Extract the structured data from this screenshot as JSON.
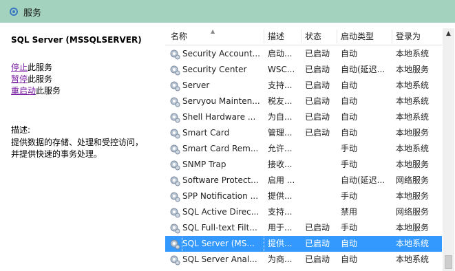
{
  "title": "服务",
  "left": {
    "service_name": "SQL Server (MSSQLSERVER)",
    "actions": [
      {
        "link": "停止",
        "suffix": "此服务"
      },
      {
        "link": "暂停",
        "suffix": "此服务"
      },
      {
        "link": "重启动",
        "suffix": "此服务"
      }
    ],
    "desc_label": "描述:",
    "desc_lines": [
      "提供数据的存储、处理和受控访问，",
      "并提供快速的事务处理。"
    ]
  },
  "columns": [
    "名称",
    "描述",
    "状态",
    "启动类型",
    "登录为"
  ],
  "rows": [
    {
      "name": "Security Account...",
      "desc": "启动...",
      "status": "已启动",
      "startup": "自动",
      "logon": "本地系统"
    },
    {
      "name": "Security Center",
      "desc": "WSC...",
      "status": "已启动",
      "startup": "自动(延迟...",
      "logon": "本地服务"
    },
    {
      "name": "Server",
      "desc": "支持...",
      "status": "已启动",
      "startup": "自动",
      "logon": "本地系统"
    },
    {
      "name": "Servyou Mainten...",
      "desc": "税友...",
      "status": "已启动",
      "startup": "自动",
      "logon": "本地系统"
    },
    {
      "name": "Shell Hardware ...",
      "desc": "为自...",
      "status": "已启动",
      "startup": "自动",
      "logon": "本地系统"
    },
    {
      "name": "Smart Card",
      "desc": "管理...",
      "status": "已启动",
      "startup": "自动",
      "logon": "本地服务"
    },
    {
      "name": "Smart Card Rem...",
      "desc": "允许...",
      "status": "",
      "startup": "手动",
      "logon": "本地系统"
    },
    {
      "name": "SNMP Trap",
      "desc": "接收...",
      "status": "",
      "startup": "手动",
      "logon": "本地服务"
    },
    {
      "name": "Software Protect...",
      "desc": "启用 ...",
      "status": "",
      "startup": "自动(延迟...",
      "logon": "网络服务"
    },
    {
      "name": "SPP Notification ...",
      "desc": "提供...",
      "status": "",
      "startup": "手动",
      "logon": "本地服务"
    },
    {
      "name": "SQL Active Direc...",
      "desc": "支持...",
      "status": "",
      "startup": "禁用",
      "logon": "网络服务"
    },
    {
      "name": "SQL Full-text Filt...",
      "desc": "用于...",
      "status": "已启动",
      "startup": "手动",
      "logon": "本地服务"
    },
    {
      "name": "SQL Server (MS...",
      "desc": "提供...",
      "status": "已启动",
      "startup": "自动",
      "logon": "本地系统",
      "selected": true
    },
    {
      "name": "SQL Server Anal...",
      "desc": "为商...",
      "status": "已启动",
      "startup": "自动",
      "logon": "本地系统"
    }
  ]
}
